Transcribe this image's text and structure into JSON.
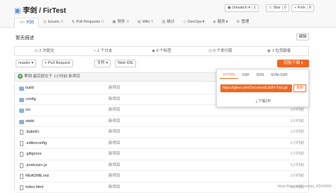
{
  "header": {
    "repo_title": "李剑 / FirTest",
    "watch": {
      "label": "Unwatch",
      "count": "1"
    },
    "star": {
      "label": "Star",
      "count": "0"
    },
    "fork": {
      "label": "Fork",
      "count": "0"
    },
    "tabs": [
      {
        "icon": "</>",
        "label": "代码"
      },
      {
        "icon": "◎",
        "label": "Issues",
        "count": "0"
      },
      {
        "icon": "⇅",
        "label": "Pull Requests",
        "count": "0"
      },
      {
        "icon": "▣",
        "label": "附件",
        "count": "0"
      },
      {
        "icon": "▤",
        "label": "Wiki",
        "count": "0"
      },
      {
        "icon": "▥",
        "label": "统计"
      },
      {
        "icon": "◇",
        "label": "DevOps",
        "dropdown": "▾"
      },
      {
        "icon": "◈",
        "label": "服务",
        "dropdown": "▾"
      },
      {
        "icon": "⚙",
        "label": "管理"
      }
    ]
  },
  "description": "暂无描述",
  "edit_label": "编辑",
  "stats": [
    {
      "icon": "◷",
      "text": "2 次提交"
    },
    {
      "icon": "⑂",
      "text": "1 个分支"
    },
    {
      "icon": "◆",
      "text": "0 个标签"
    },
    {
      "icon": "◷",
      "text": "0 个发行版"
    },
    {
      "icon": "◉",
      "text": "1 位贡献者"
    }
  ],
  "toolbar": {
    "branch": "master",
    "pull_request": "+ Pull Request",
    "file": "文件",
    "webide": "Web IDE",
    "clone": "克隆/下载"
  },
  "commit": {
    "avatar": "李",
    "author": "李剑",
    "message": "最后提交于 1小时前 新项目"
  },
  "files": [
    {
      "name": "build",
      "type": "dir",
      "msg": "新项目",
      "time": "1小时前"
    },
    {
      "name": "config",
      "type": "dir",
      "msg": "新项目",
      "time": "1小时前"
    },
    {
      "name": "src",
      "type": "dir",
      "msg": "新项目",
      "time": "1小时前"
    },
    {
      "name": "static",
      "type": "dir",
      "msg": "新项目",
      "time": "1小时前"
    },
    {
      "name": ".babelrc",
      "type": "file",
      "msg": "新项目",
      "time": "1小时前"
    },
    {
      "name": ".editorconfig",
      "type": "file",
      "msg": "新项目",
      "time": "1小时前"
    },
    {
      "name": ".gitignore",
      "type": "file",
      "msg": "新项目",
      "time": "1小时前"
    },
    {
      "name": ".postcssrc.js",
      "type": "file",
      "msg": "新项目",
      "time": "1小时前"
    },
    {
      "name": "README.md",
      "type": "file",
      "msg": "新项目",
      "time": "1小时前"
    },
    {
      "name": "index.html",
      "type": "file",
      "msg": "新项目",
      "time": "1小时前"
    }
  ],
  "clone_popup": {
    "tabs": [
      "HTTPS",
      "SSH",
      "SVN",
      "SVN+SSH"
    ],
    "active_tab": "HTTPS",
    "url": "https://gitee.com/DocumentList/FirTest.git",
    "copy": "复制",
    "download": "下载ZIP"
  },
  "watermark": "https://blog.csdn.net/qq_42564846"
}
